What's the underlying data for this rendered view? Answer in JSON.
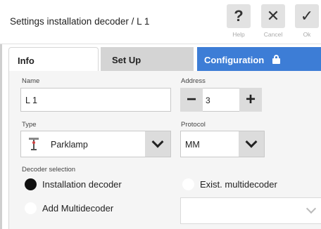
{
  "header": {
    "title": "Settings installation decoder / L 1",
    "help_label": "Help",
    "cancel_label": "Cancel",
    "ok_label": "Ok"
  },
  "tabs": [
    {
      "label": "Info",
      "active": true
    },
    {
      "label": "Set Up",
      "active": false
    },
    {
      "label": "Configuration",
      "active": false,
      "icon": "lock-icon"
    }
  ],
  "colors": {
    "config_tab": "#3d7dd6",
    "panel_bg": "#f5f5f5"
  },
  "info": {
    "name_label": "Name",
    "name_value": "L 1",
    "address_label": "Address",
    "address_value": "3",
    "type_label": "Type",
    "type_value": "Parklamp",
    "protocol_label": "Protocol",
    "protocol_value": "MM",
    "decoder_selection_label": "Decoder selection",
    "options": {
      "installation": "Installation decoder",
      "existing_multi": "Exist. multidecoder",
      "add_multi": "Add Multidecoder"
    },
    "selected_option": "installation"
  }
}
